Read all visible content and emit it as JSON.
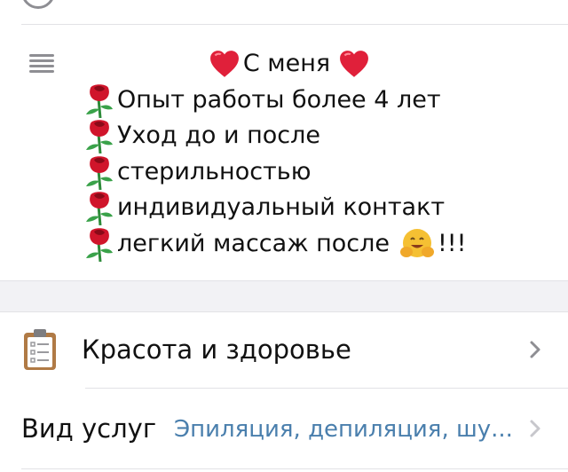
{
  "description": {
    "title_line": "С меня",
    "items": [
      "Опыт работы более 4 лет",
      "Уход до и после",
      "стерильностью",
      "индивидуальный контакт",
      "легкий массаж после"
    ],
    "last_item_suffix": "!!!"
  },
  "category_row": {
    "label": "Красота и здоровье",
    "icon": "clipboard-icon"
  },
  "service_row": {
    "label": "Вид услуг",
    "value": "Эпиляция, депиляция, шу..."
  },
  "colors": {
    "link_blue": "#4a7fad",
    "divider": "#e2e2e6",
    "icon_gray": "#8e8e93",
    "heart_red": "#e0203a"
  },
  "icons": [
    "description-lines-icon",
    "heart-icon",
    "rose-icon",
    "hugging-face-icon",
    "clipboard-icon",
    "chevron-right-icon"
  ]
}
